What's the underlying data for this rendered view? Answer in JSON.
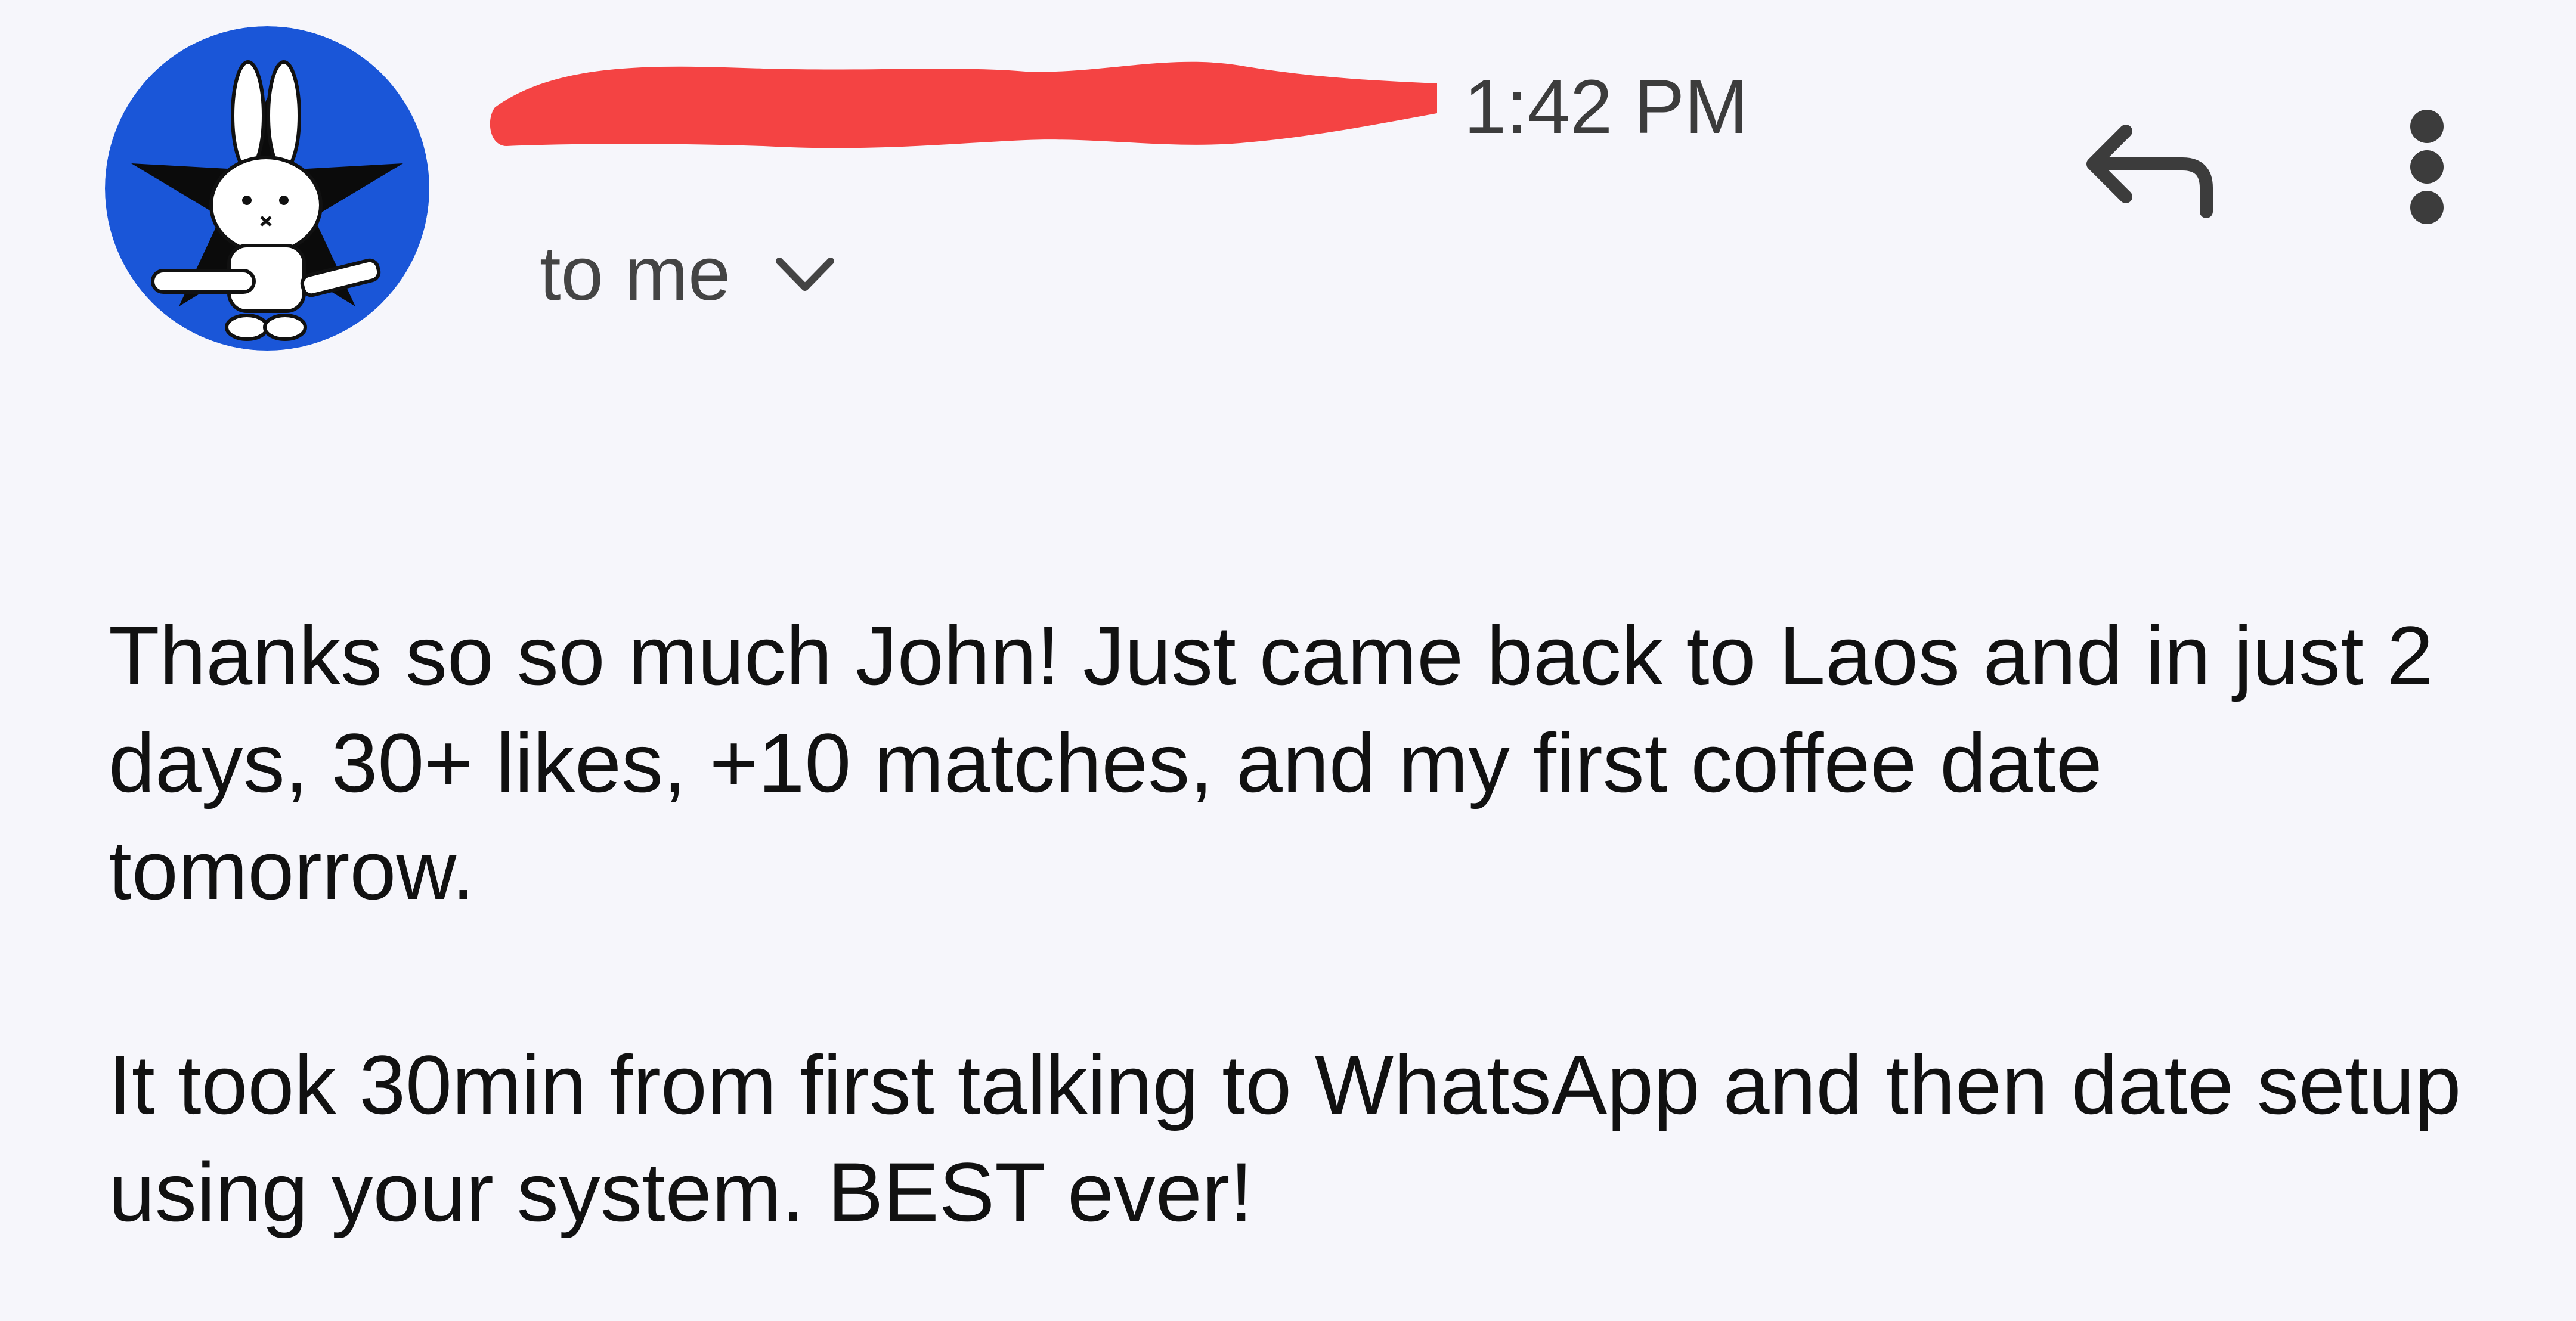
{
  "header": {
    "sender_name": "",
    "time": "1:42 PM",
    "recipient_label": "to me",
    "icons": {
      "avatar": "avatar-bunny-star",
      "reply": "reply-icon",
      "more": "more-vertical-icon",
      "expand": "chevron-down-icon"
    }
  },
  "message": {
    "paragraphs": [
      "Thanks so so much John! Just came back to Laos and in just 2 days, 30+ likes, +10 matches, and my first coffee date tomorrow.",
      "It took 30min from first talking to WhatsApp and then date setup using your system. BEST ever!"
    ]
  },
  "colors": {
    "background": "#f6f6fb",
    "redaction": "#f44343",
    "avatar_blue": "#1a56d8",
    "avatar_star": "#0b0b0b",
    "text": "#111111",
    "secondary_text": "#444444"
  }
}
